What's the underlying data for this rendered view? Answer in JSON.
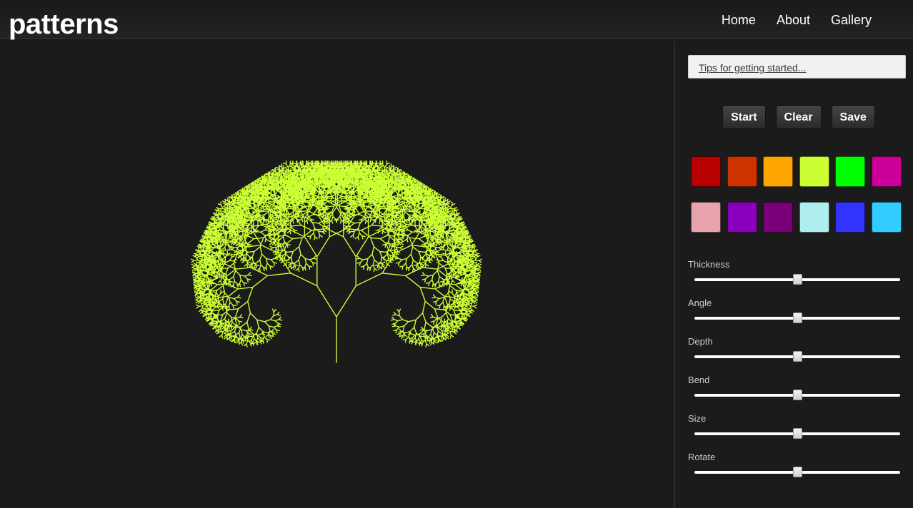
{
  "app": {
    "logo": "patterns"
  },
  "nav": {
    "items": [
      {
        "label": "Home"
      },
      {
        "label": "About"
      },
      {
        "label": "Gallery"
      }
    ]
  },
  "panel": {
    "tips_link": "Tips for getting started...",
    "buttons": {
      "start": "Start",
      "clear": "Clear",
      "save": "Save"
    },
    "swatches": [
      "#b80000",
      "#cc3300",
      "#ffa500",
      "#ccff33",
      "#00ff00",
      "#cc0099",
      "#e8a3ad",
      "#8800bb",
      "#7a007a",
      "#aeeeee",
      "#3333ff",
      "#33ccff"
    ],
    "sliders": [
      {
        "label": "Thickness",
        "value": 0.5
      },
      {
        "label": "Angle",
        "value": 0.5
      },
      {
        "label": "Depth",
        "value": 0.5
      },
      {
        "label": "Bend",
        "value": 0.5
      },
      {
        "label": "Size",
        "value": 0.5
      },
      {
        "label": "Rotate",
        "value": 0.5
      }
    ]
  },
  "canvas": {
    "stroke_color": "#ccff33"
  }
}
